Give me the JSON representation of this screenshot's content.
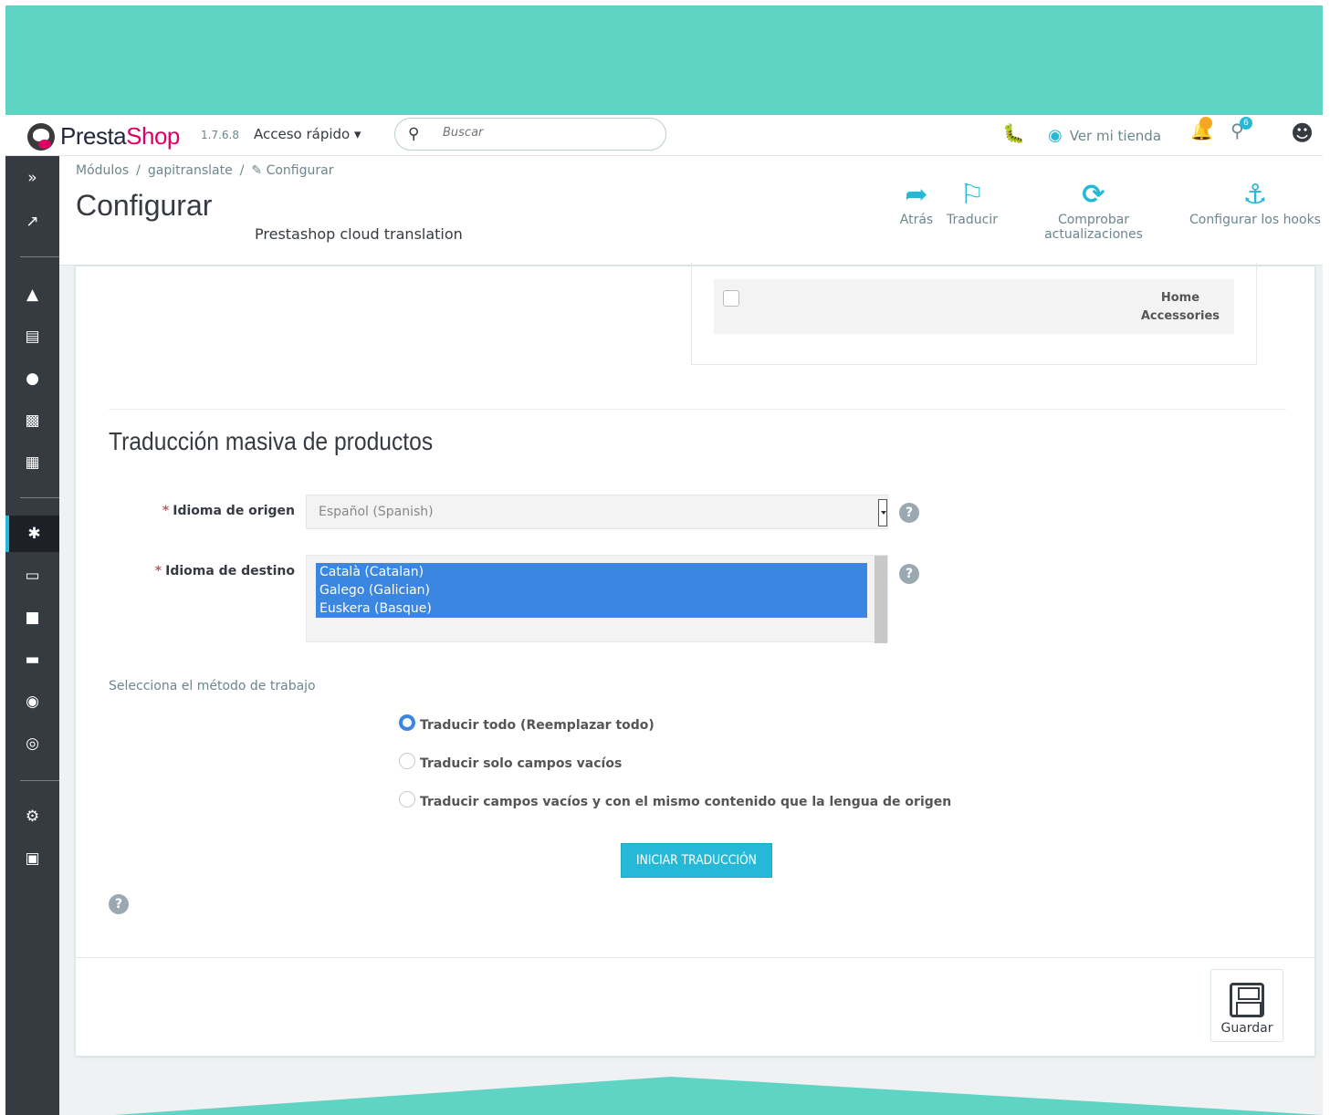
{
  "header": {
    "logo_presta": "Presta",
    "logo_shop": "Shop",
    "version": "1.7.6.8",
    "quick_access": "Acceso rápido ▾",
    "search_placeholder": "Buscar",
    "view_store": "Ver mi tienda",
    "notif_orders_badge": "",
    "notif_customers_badge": "6"
  },
  "breadcrumb": [
    "Módulos",
    "gapitranslate",
    "Configurar"
  ],
  "page": {
    "title": "Configurar",
    "subtitle": "Prestashop cloud translation"
  },
  "toolbar": [
    {
      "label": "Atrás",
      "icon": "arrow-circle-left-icon"
    },
    {
      "label": "Traducir",
      "icon": "flag-icon"
    },
    {
      "label": "Comprobar actualizaciones",
      "icon": "refresh-icon"
    },
    {
      "label": "Configurar los hooks",
      "icon": "anchor-icon"
    }
  ],
  "tree": {
    "path_line1": "Home",
    "path_line2": "Accessories"
  },
  "mass_translation": {
    "title": "Traducción masiva de productos",
    "required_mark": "*",
    "source_label": "Idioma de origen",
    "source_value": "Español (Spanish)",
    "target_label": "Idioma de destino",
    "target_options": [
      "Català (Catalan)",
      "Galego (Galician)",
      "Euskera (Basque)"
    ],
    "method_label": "Selecciona el método de trabajo",
    "methods": [
      {
        "label": "Traducir todo (Reemplazar todo)",
        "selected": true
      },
      {
        "label": "Traducir solo campos vacíos",
        "selected": false
      },
      {
        "label": "Traducir campos vacíos y con el mismo contenido que la lengua de origen",
        "selected": false
      }
    ],
    "start_button": "INICIAR TRADUCCIÓN"
  },
  "footer": {
    "save_label": "Guardar"
  },
  "colors": {
    "accent": "#25b9d7",
    "frame": "#5fd3c4",
    "sidebar": "#363a41",
    "selected_option": "#3b86e0"
  }
}
